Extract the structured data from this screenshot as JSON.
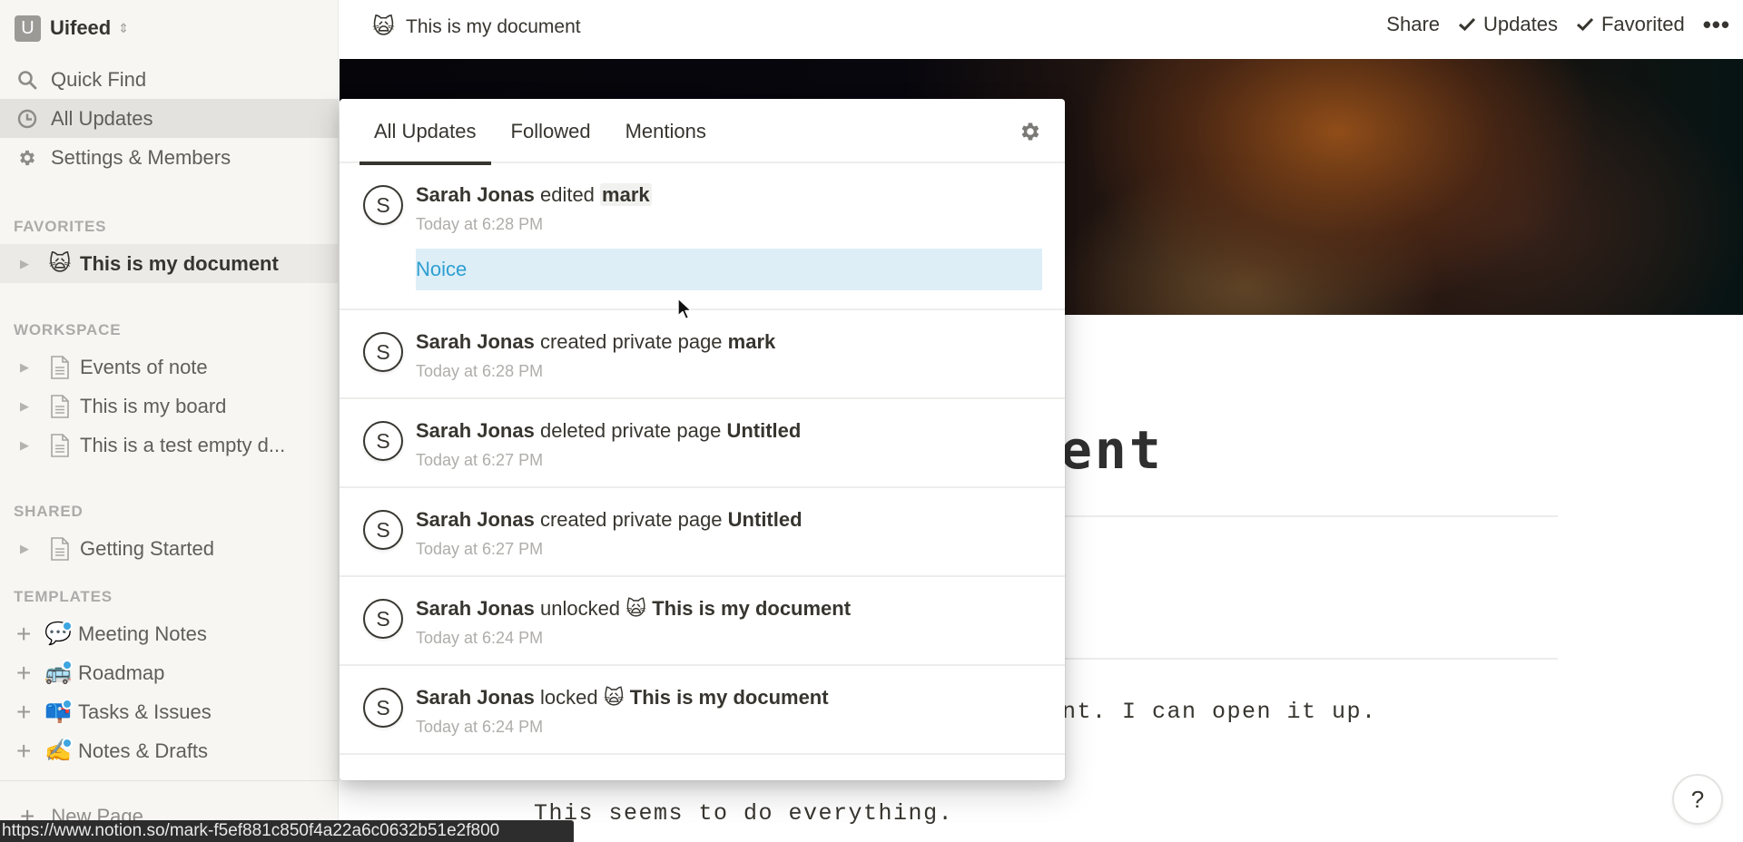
{
  "workspace": {
    "avatar_letter": "U",
    "name": "Uifeed",
    "switch_icon": "chevron-up-down-icon"
  },
  "sidebar": {
    "nav": [
      {
        "label": "Quick Find",
        "icon": "search-icon",
        "active": false
      },
      {
        "label": "All Updates",
        "icon": "clock-icon",
        "active": true
      },
      {
        "label": "Settings & Members",
        "icon": "gear-icon",
        "active": false
      }
    ],
    "sections": {
      "favorites": {
        "label": "FAVORITES",
        "items": [
          {
            "label": "This is my document",
            "emoji": "🙀"
          }
        ]
      },
      "workspace": {
        "label": "WORKSPACE",
        "items": [
          {
            "label": "Events of note"
          },
          {
            "label": "This is my board"
          },
          {
            "label": "This is a test empty d..."
          }
        ]
      },
      "shared": {
        "label": "SHARED",
        "items": [
          {
            "label": "Getting Started"
          }
        ]
      },
      "templates": {
        "label": "TEMPLATES",
        "items": [
          {
            "label": "Meeting Notes",
            "emoji": "💬"
          },
          {
            "label": "Roadmap",
            "emoji": "🚌"
          },
          {
            "label": "Tasks & Issues",
            "emoji": "📪"
          },
          {
            "label": "Notes & Drafts",
            "emoji": "✍️"
          }
        ]
      }
    },
    "new_page_label": "New Page"
  },
  "header": {
    "breadcrumb": {
      "emoji": "🙀",
      "title": "This is my document"
    },
    "actions": {
      "share": "Share",
      "updates": "Updates",
      "favorited": "Favorited",
      "more": "•••"
    }
  },
  "page": {
    "title_visible": "ent",
    "line1_visible": "nt. I can open it up.",
    "line2": "This seems to do everything."
  },
  "updates_popover": {
    "tabs": [
      {
        "label": "All Updates",
        "active": true
      },
      {
        "label": "Followed",
        "active": false
      },
      {
        "label": "Mentions",
        "active": false
      }
    ],
    "settings_icon": "gear-icon",
    "items": [
      {
        "avatar": "S",
        "user": "Sarah Jonas",
        "action": "edited",
        "target": "mark",
        "target_emoji": "",
        "time": "Today at 6:28 PM",
        "preview": "Noice"
      },
      {
        "avatar": "S",
        "user": "Sarah Jonas",
        "action": "created private page",
        "target": "mark",
        "target_emoji": "",
        "time": "Today at 6:28 PM"
      },
      {
        "avatar": "S",
        "user": "Sarah Jonas",
        "action": "deleted private page",
        "target": "Untitled",
        "target_emoji": "",
        "time": "Today at 6:27 PM"
      },
      {
        "avatar": "S",
        "user": "Sarah Jonas",
        "action": "created private page",
        "target": "Untitled",
        "target_emoji": "",
        "time": "Today at 6:27 PM"
      },
      {
        "avatar": "S",
        "user": "Sarah Jonas",
        "action": "unlocked",
        "target": "This is my document",
        "target_emoji": "🙀",
        "time": "Today at 6:24 PM"
      },
      {
        "avatar": "S",
        "user": "Sarah Jonas",
        "action": "locked",
        "target": "This is my document",
        "target_emoji": "🙀",
        "time": "Today at 6:24 PM"
      }
    ]
  },
  "help_button": {
    "label": "?"
  },
  "status_bar": {
    "url": "https://www.notion.so/mark-f5ef881c850f4a22a6c0632b51e2f800"
  },
  "colors": {
    "sidebar_bg": "#f7f6f3",
    "active_nav_bg": "#e3e2df",
    "preview_bg": "#ddeef7",
    "preview_text": "#2e9fd1",
    "new_badge": "#3ea5e0"
  }
}
